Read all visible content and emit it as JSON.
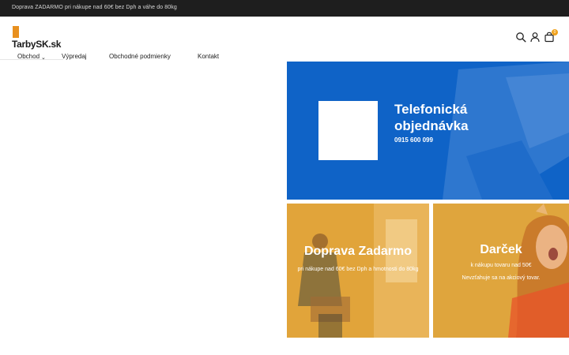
{
  "topbar": {
    "text": "Doprava ZADARMO pri nákupe nad 60€ bez Dph a váhe do 80kg"
  },
  "logo": {
    "text": "TarbySK.sk",
    "accent_color": "#e8901f"
  },
  "header_icons": {
    "search": "search-icon",
    "user": "user-icon",
    "cart": "cart-icon",
    "cart_count": "0"
  },
  "nav": {
    "items": [
      {
        "label": "Obchod",
        "has_dropdown": true
      },
      {
        "label": "Výpredaj"
      },
      {
        "label": "Obchodné podmienky"
      },
      {
        "label": "Kontakt"
      }
    ]
  },
  "banners": {
    "phone": {
      "title": "Telefonická objednávka",
      "number": "0915 600 099",
      "bg_color": "#0f63c7"
    },
    "shipping": {
      "title": "Doprava Zadarmo",
      "subtitle": "pri nákupe nad 60€ bez Dph a hmotnosti do 80kg",
      "bg_color": "#e1a43a"
    },
    "gift": {
      "title": "Darček",
      "line1": "k nákupu tovaru nad 50€",
      "line2": "Nevzťahuje sa na akciový tovar.",
      "bg_color": "#dfa53d"
    }
  }
}
